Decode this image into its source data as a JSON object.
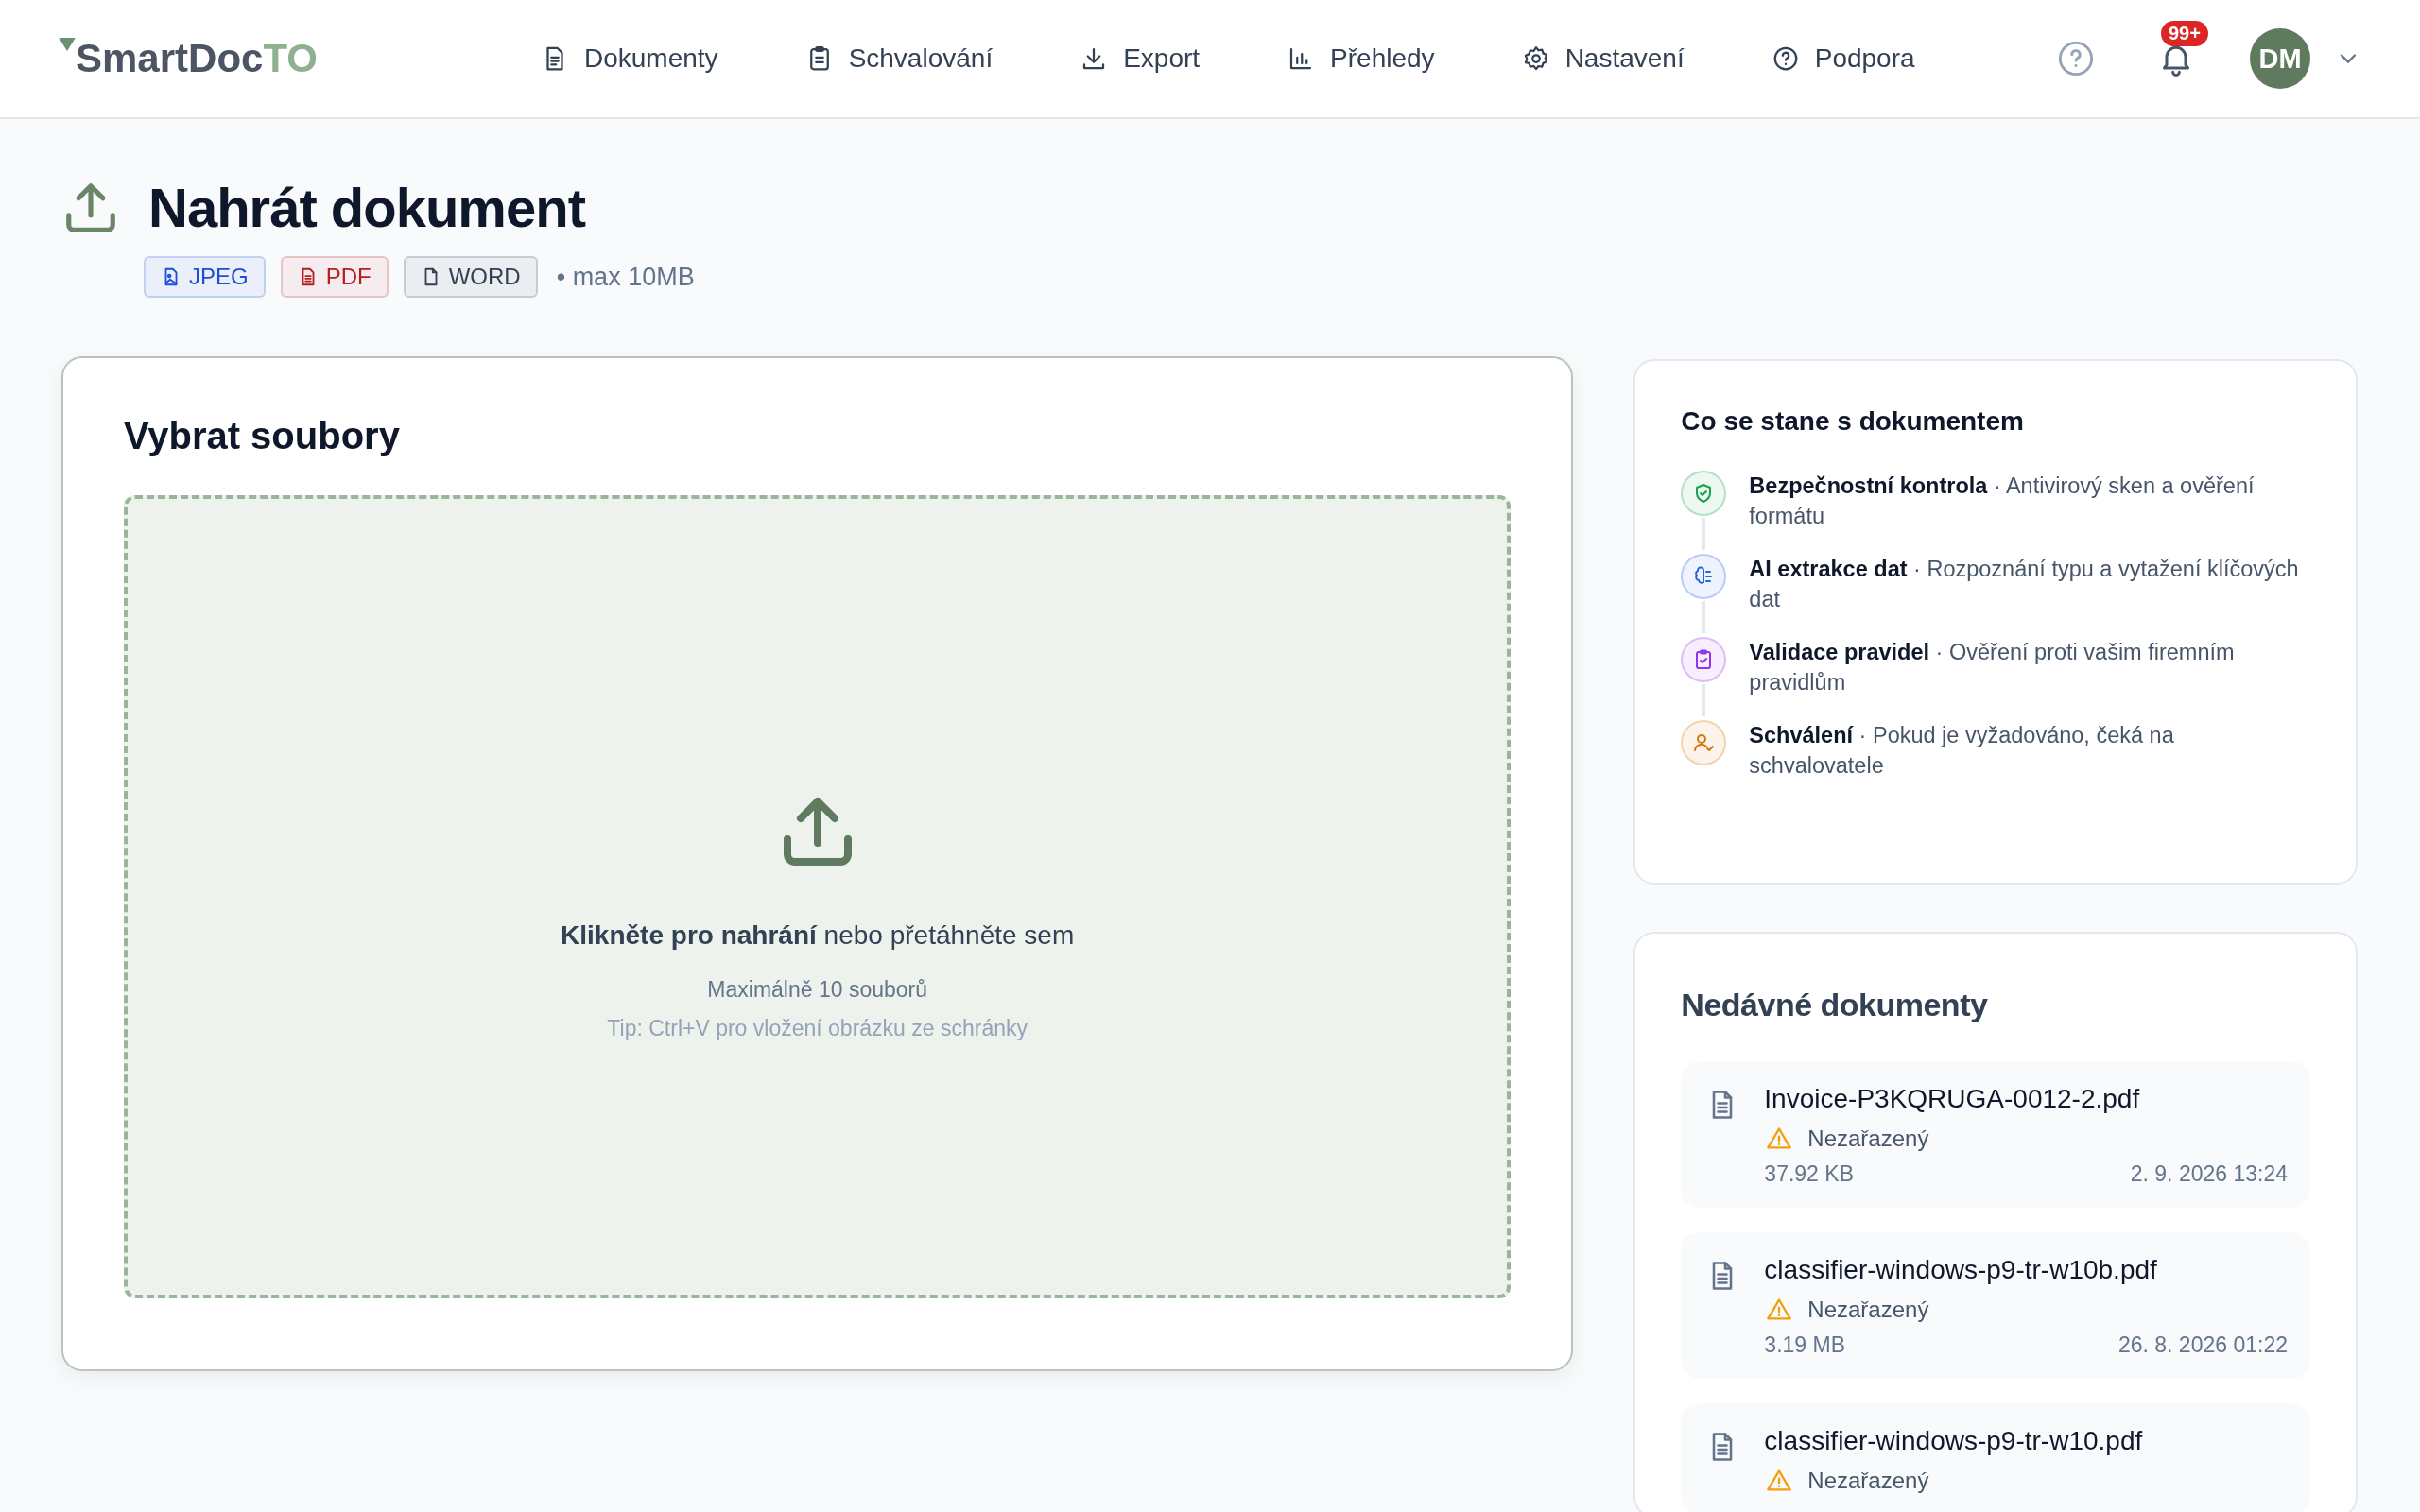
{
  "logo": {
    "main": "SmartDoc",
    "accent": "TO"
  },
  "nav": [
    {
      "label": "Dokumenty"
    },
    {
      "label": "Schvalování"
    },
    {
      "label": "Export"
    },
    {
      "label": "Přehledy"
    },
    {
      "label": "Nastavení"
    },
    {
      "label": "Podpora"
    }
  ],
  "header": {
    "notifications": "99+",
    "avatar": "DM"
  },
  "page": {
    "title": "Nahrát dokument",
    "tags": [
      {
        "label": "JPEG",
        "kind": "image",
        "color": "#1d4ed8"
      },
      {
        "label": "PDF",
        "kind": "pdf",
        "color": "#b91c1c"
      },
      {
        "label": "WORD",
        "kind": "file",
        "color": "#334155"
      }
    ],
    "limit": "• max 10MB"
  },
  "upload": {
    "title": "Vybrat soubory",
    "prompt": "**Klikněte pro nahrání** nebo přetáhněte sem",
    "max_files": "Maximálně 10 souborů",
    "tip": "Tip: Ctrl+V pro vložení obrázku ze schránky"
  },
  "process": {
    "title": "Co se stane s dokumentem",
    "steps": [
      {
        "text": "**Bezpečnostní kontrola** · Antivirový sken a ověření formátu",
        "kind": "shield",
        "color": "#16a34a"
      },
      {
        "text": "**AI extrakce dat** · Rozpoznání typu a vytažení klíčových dat",
        "kind": "brain",
        "color": "#2563eb"
      },
      {
        "text": "**Validace pravidel** · Ověření proti vašim firemním pravidlům",
        "kind": "clipboard",
        "color": "#9333ea"
      },
      {
        "text": "**Schválení** · Pokud je vyžadováno, čeká na schvalovatele",
        "kind": "user",
        "color": "#d97706"
      }
    ]
  },
  "recent": {
    "title": "Nedávné dokumenty",
    "items": [
      {
        "name": "Invoice-P3KQRUGA-0012-2.pdf",
        "status": "Nezařazený",
        "size": "37.92 KB",
        "date": "2. 9. 2026 13:24"
      },
      {
        "name": "classifier-windows-p9-tr-w10b.pdf",
        "status": "Nezařazený",
        "size": "3.19 MB",
        "date": "26. 8. 2026 01:22"
      },
      {
        "name": "classifier-windows-p9-tr-w10.pdf",
        "status": "Nezařazený"
      }
    ]
  }
}
